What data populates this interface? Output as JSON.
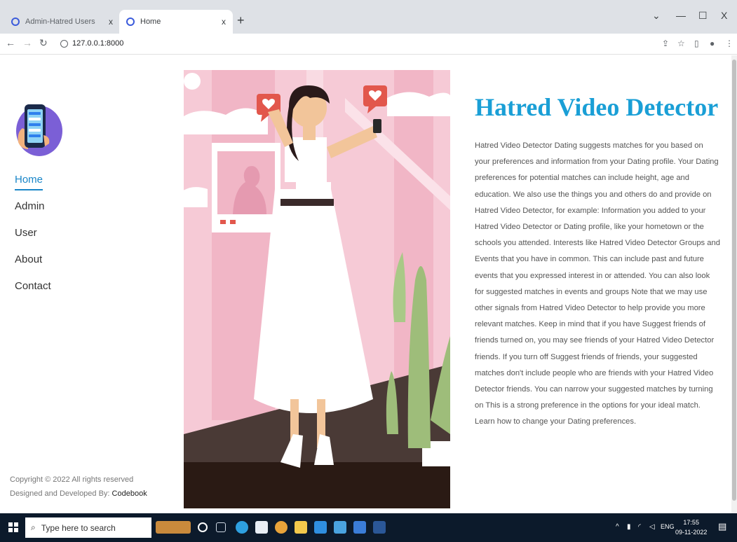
{
  "browser": {
    "tabs": [
      {
        "title": "Admin-Hatred Users",
        "active": false
      },
      {
        "title": "Home",
        "active": true
      }
    ],
    "close_glyph": "x",
    "new_tab_glyph": "+",
    "window_controls": {
      "dropdown": "⌄",
      "minimize": "—",
      "maximize": "☐",
      "close": "X"
    },
    "url": "127.0.0.1:8000"
  },
  "sidebar": {
    "nav": [
      {
        "label": "Home",
        "active": true
      },
      {
        "label": "Admin",
        "active": false
      },
      {
        "label": "User",
        "active": false
      },
      {
        "label": "About",
        "active": false
      },
      {
        "label": "Contact",
        "active": false
      }
    ],
    "copyright": "Copyright © 2022 All rights reserved",
    "designed_prefix": "Designed and Developed By:",
    "designer": "Codebook"
  },
  "main": {
    "title": "Hatred Video Detector",
    "description": "Hatred Video Detector Dating suggests matches for you based on your preferences and information from your Dating profile. Your Dating preferences for potential matches can include height, age and education. We also use the things you and others do and provide on Hatred Video Detector, for example: Information you added to your Hatred Video Detector or Dating profile, like your hometown or the schools you attended. Interests like Hatred Video Detector Groups and Events that you have in common. This can include past and future events that you expressed interest in or attended. You can also look for suggested matches in events and groups Note that we may use other signals from Hatred Video Detector to help provide you more relevant matches. Keep in mind that if you have Suggest friends of friends turned on, you may see friends of your Hatred Video Detector friends. If you turn off Suggest friends of friends, your suggested matches don't include people who are friends with your Hatred Video Detector friends. You can narrow your suggested matches by turning on This is a strong preference in the options for your ideal match. Learn how to change your Dating preferences."
  },
  "taskbar": {
    "search_placeholder": "Type here to search",
    "tray_lang": "ENG",
    "time": "17:55",
    "date": "09-11-2022"
  },
  "colors": {
    "accent": "#1a9fd6",
    "nav_active": "#1a86c8",
    "hero_pink": "#f4c0cf",
    "taskbar": "#0c1a2b"
  }
}
